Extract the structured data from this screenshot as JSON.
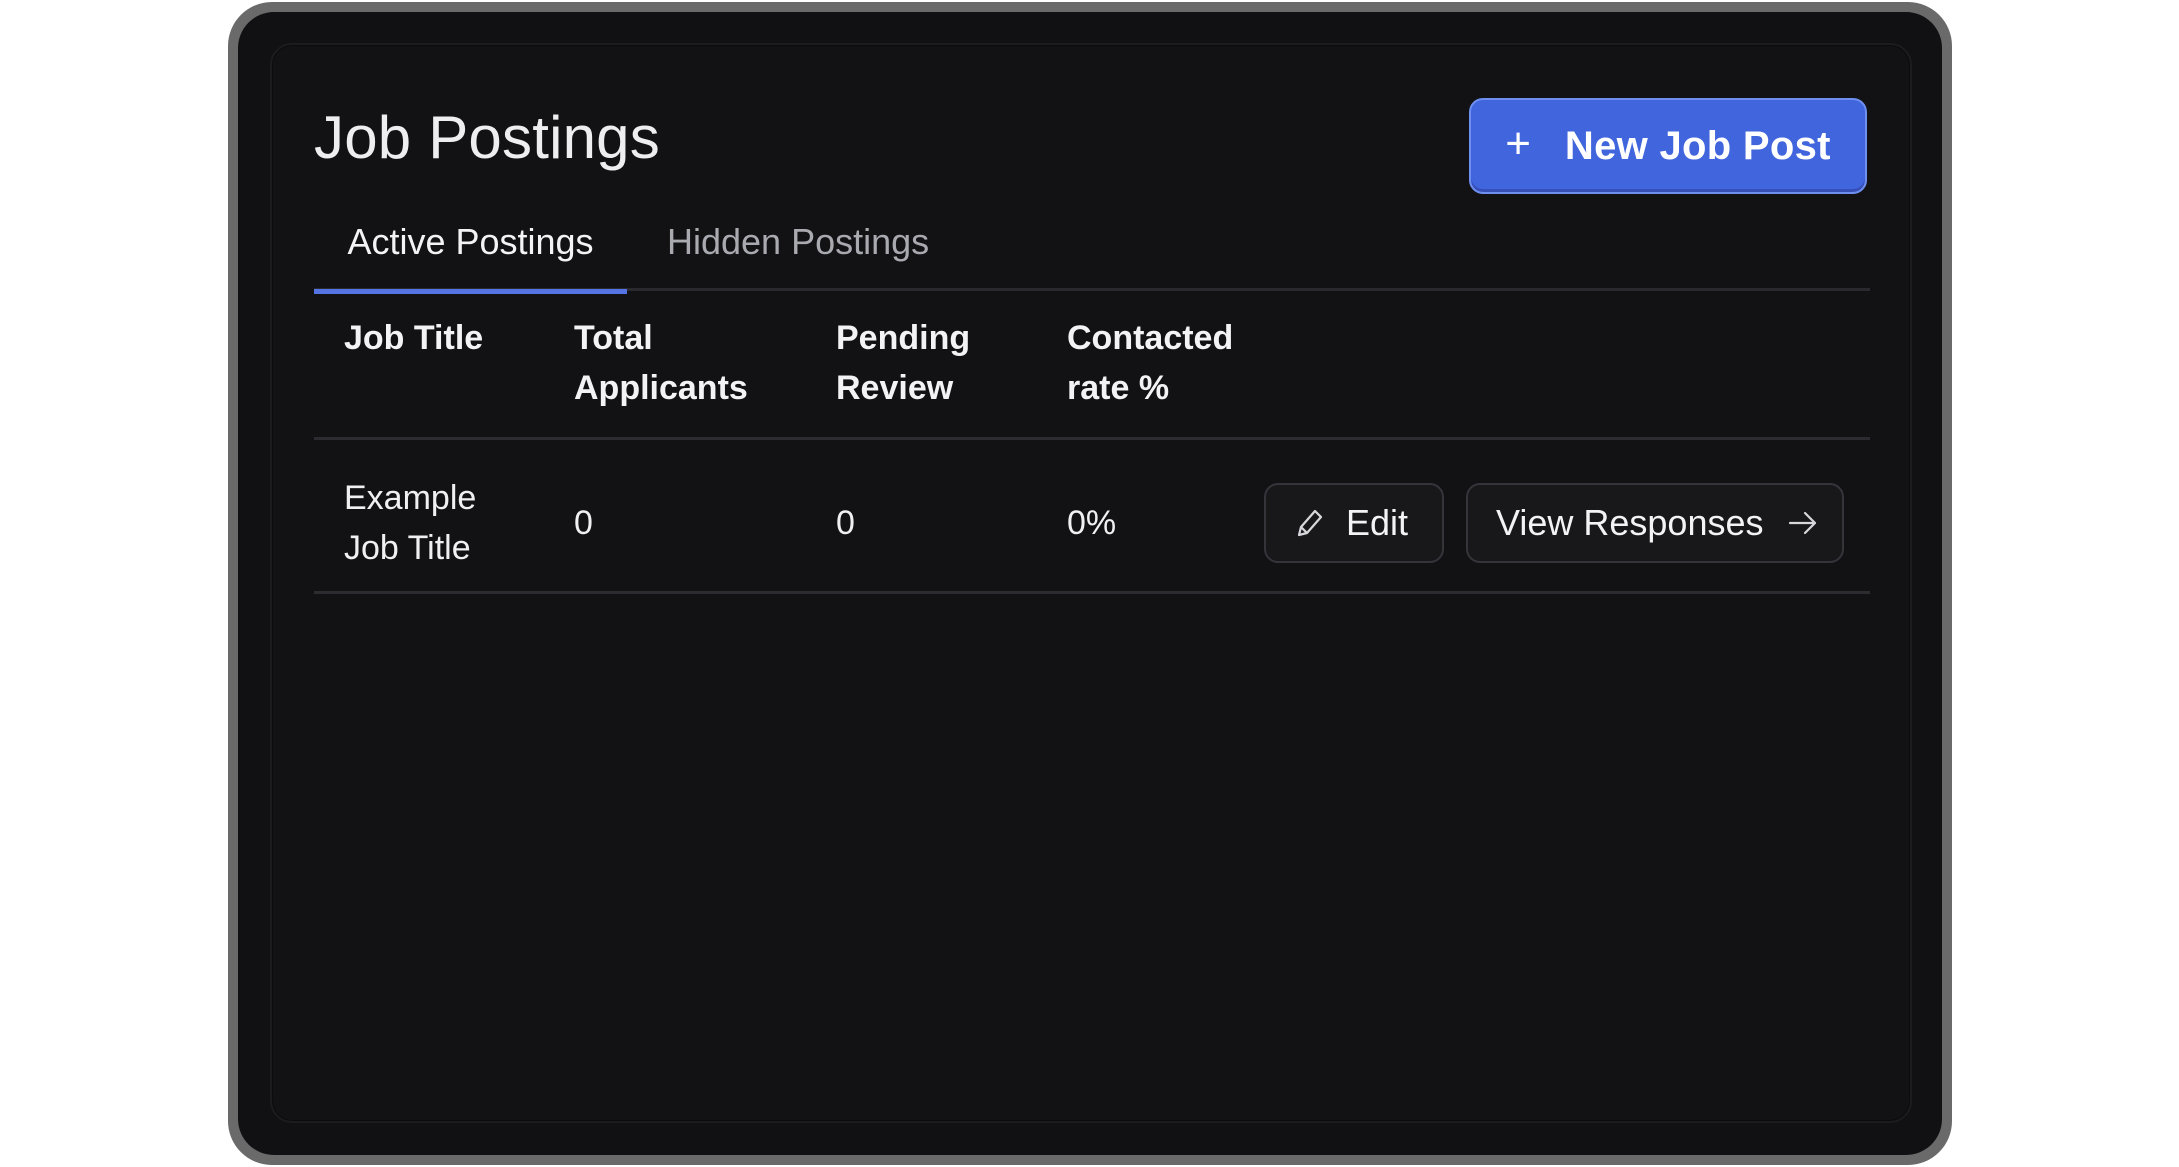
{
  "page": {
    "title": "Job Postings",
    "new_button": {
      "icon": "plus-icon",
      "label": "New Job Post"
    }
  },
  "tabs": [
    {
      "label": "Active Postings",
      "active": true
    },
    {
      "label": "Hidden Postings",
      "active": false
    }
  ],
  "table": {
    "headers": [
      [
        "Job Title"
      ],
      [
        "Total",
        "Applicants"
      ],
      [
        "Pending",
        "Review"
      ],
      [
        "Contacted",
        "rate %"
      ]
    ],
    "rows": [
      {
        "title_lines": [
          "Example",
          "Job Title"
        ],
        "total_applicants": "0",
        "pending_review": "0",
        "contacted_rate": "0%",
        "edit_label": "Edit",
        "view_label": "View Responses"
      }
    ]
  },
  "colors": {
    "accent": "#4065dd",
    "tab_underline": "#5574e4",
    "background": "#121215",
    "bezel": "#6a6a6a"
  }
}
